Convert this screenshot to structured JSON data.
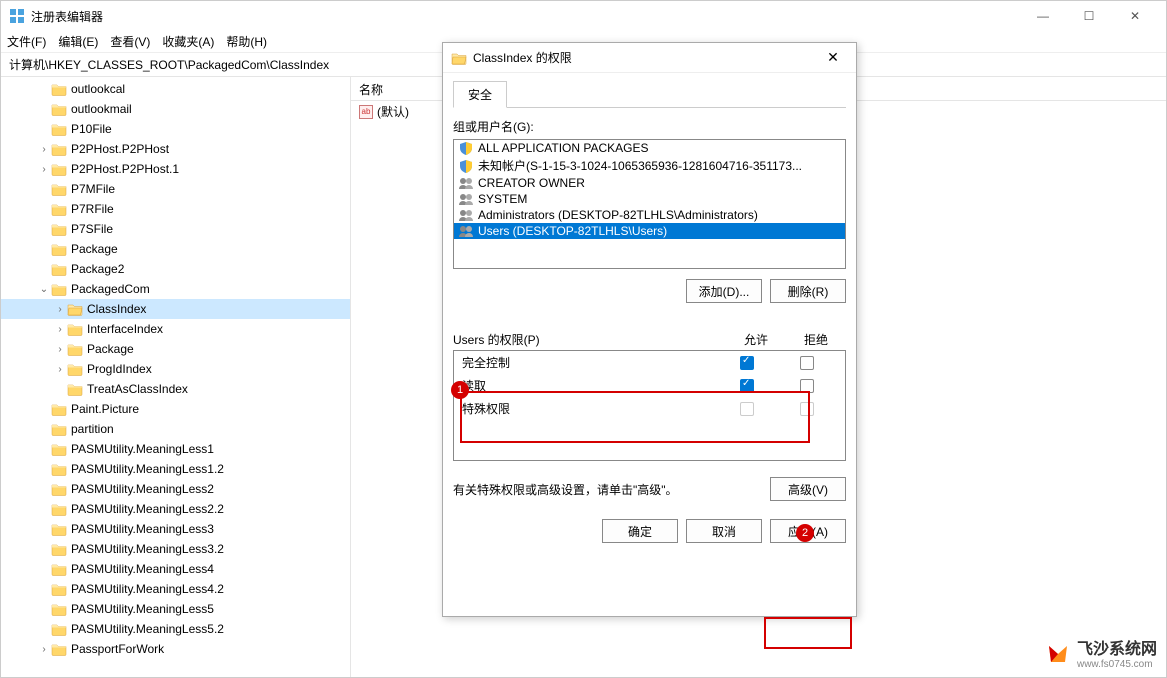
{
  "window": {
    "title": "注册表编辑器",
    "menu": [
      "文件(F)",
      "编辑(E)",
      "查看(V)",
      "收藏夹(A)",
      "帮助(H)"
    ],
    "address": "计算机\\HKEY_CLASSES_ROOT\\PackagedCom\\ClassIndex"
  },
  "tree": [
    {
      "l": 1,
      "e": "",
      "t": "outlookcal"
    },
    {
      "l": 1,
      "e": "",
      "t": "outlookmail"
    },
    {
      "l": 1,
      "e": "",
      "t": "P10File"
    },
    {
      "l": 1,
      "e": ">",
      "t": "P2PHost.P2PHost"
    },
    {
      "l": 1,
      "e": ">",
      "t": "P2PHost.P2PHost.1"
    },
    {
      "l": 1,
      "e": "",
      "t": "P7MFile"
    },
    {
      "l": 1,
      "e": "",
      "t": "P7RFile"
    },
    {
      "l": 1,
      "e": "",
      "t": "P7SFile"
    },
    {
      "l": 1,
      "e": "",
      "t": "Package"
    },
    {
      "l": 1,
      "e": "",
      "t": "Package2"
    },
    {
      "l": 1,
      "e": "v",
      "t": "PackagedCom"
    },
    {
      "l": 2,
      "e": ">",
      "t": "ClassIndex",
      "sel": true
    },
    {
      "l": 2,
      "e": ">",
      "t": "InterfaceIndex"
    },
    {
      "l": 2,
      "e": ">",
      "t": "Package"
    },
    {
      "l": 2,
      "e": ">",
      "t": "ProgIdIndex"
    },
    {
      "l": 2,
      "e": "",
      "t": "TreatAsClassIndex"
    },
    {
      "l": 1,
      "e": "",
      "t": "Paint.Picture"
    },
    {
      "l": 1,
      "e": "",
      "t": "partition"
    },
    {
      "l": 1,
      "e": "",
      "t": "PASMUtility.MeaningLess1"
    },
    {
      "l": 1,
      "e": "",
      "t": "PASMUtility.MeaningLess1.2"
    },
    {
      "l": 1,
      "e": "",
      "t": "PASMUtility.MeaningLess2"
    },
    {
      "l": 1,
      "e": "",
      "t": "PASMUtility.MeaningLess2.2"
    },
    {
      "l": 1,
      "e": "",
      "t": "PASMUtility.MeaningLess3"
    },
    {
      "l": 1,
      "e": "",
      "t": "PASMUtility.MeaningLess3.2"
    },
    {
      "l": 1,
      "e": "",
      "t": "PASMUtility.MeaningLess4"
    },
    {
      "l": 1,
      "e": "",
      "t": "PASMUtility.MeaningLess4.2"
    },
    {
      "l": 1,
      "e": "",
      "t": "PASMUtility.MeaningLess5"
    },
    {
      "l": 1,
      "e": "",
      "t": "PASMUtility.MeaningLess5.2"
    },
    {
      "l": 1,
      "e": ">",
      "t": "PassportForWork"
    }
  ],
  "list": {
    "header": "名称",
    "default_icon_label": "ab",
    "default_value": "(默认)"
  },
  "dialog": {
    "title": "ClassIndex 的权限",
    "tab": "安全",
    "group_label": "组或用户名(G):",
    "users": [
      "ALL APPLICATION PACKAGES",
      "未知帐户(S-1-15-3-1024-1065365936-1281604716-351173...",
      "CREATOR OWNER",
      "SYSTEM",
      "Administrators (DESKTOP-82TLHLS\\Administrators)",
      "Users (DESKTOP-82TLHLS\\Users)"
    ],
    "add_btn": "添加(D)...",
    "remove_btn": "删除(R)",
    "perm_label": "Users 的权限(P)",
    "col_allow": "允许",
    "col_deny": "拒绝",
    "perms": [
      {
        "name": "完全控制",
        "allow": true,
        "deny": false
      },
      {
        "name": "读取",
        "allow": true,
        "deny": false
      },
      {
        "name": "特殊权限",
        "allow": false,
        "deny": false,
        "dim": true
      }
    ],
    "adv_text": "有关特殊权限或高级设置，请单击\"高级\"。",
    "adv_btn": "高级(V)",
    "ok_btn": "确定",
    "cancel_btn": "取消",
    "apply_btn": "应用(A)"
  },
  "annotations": {
    "badge1": "1",
    "badge2": "2"
  },
  "watermark": {
    "title": "飞沙系统网",
    "url": "www.fs0745.com"
  }
}
